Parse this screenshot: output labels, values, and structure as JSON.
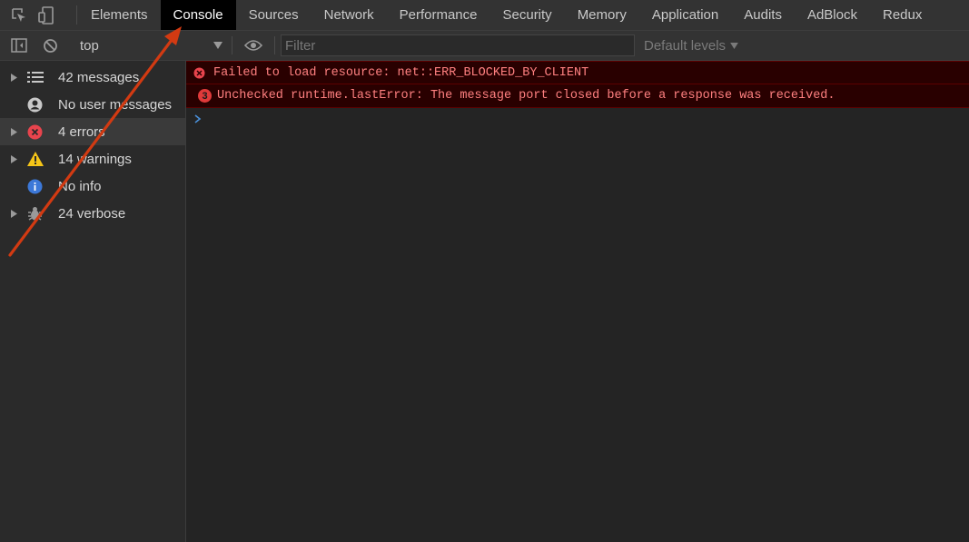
{
  "tabs": {
    "items": [
      {
        "label": "Elements"
      },
      {
        "label": "Console"
      },
      {
        "label": "Sources"
      },
      {
        "label": "Network"
      },
      {
        "label": "Performance"
      },
      {
        "label": "Security"
      },
      {
        "label": "Memory"
      },
      {
        "label": "Application"
      },
      {
        "label": "Audits"
      },
      {
        "label": "AdBlock"
      },
      {
        "label": "Redux"
      }
    ],
    "selected": "Console"
  },
  "toolbar": {
    "context": "top",
    "filter_placeholder": "Filter",
    "levels_label": "Default levels"
  },
  "sidebar": {
    "items": [
      {
        "label": "42 messages",
        "icon": "list-icon",
        "expandable": true
      },
      {
        "label": "No user messages",
        "icon": "user-icon",
        "expandable": false
      },
      {
        "label": "4 errors",
        "icon": "error-icon",
        "expandable": true,
        "selected": true
      },
      {
        "label": "14 warnings",
        "icon": "warning-icon",
        "expandable": true
      },
      {
        "label": "No info",
        "icon": "info-icon",
        "expandable": false
      },
      {
        "label": "24 verbose",
        "icon": "bug-icon",
        "expandable": true
      }
    ]
  },
  "console": {
    "messages": [
      {
        "text": "Failed to load resource: net::ERR_BLOCKED_BY_CLIENT",
        "level": "error"
      },
      {
        "text": "Unchecked runtime.lastError: The message port closed before a response was received.",
        "level": "error",
        "repeat_count": "3"
      }
    ]
  },
  "colors": {
    "error": "#ff8080",
    "error_background": "#290000",
    "annotation_arrow": "#d23a12",
    "prompt": "#4a8fd8"
  }
}
